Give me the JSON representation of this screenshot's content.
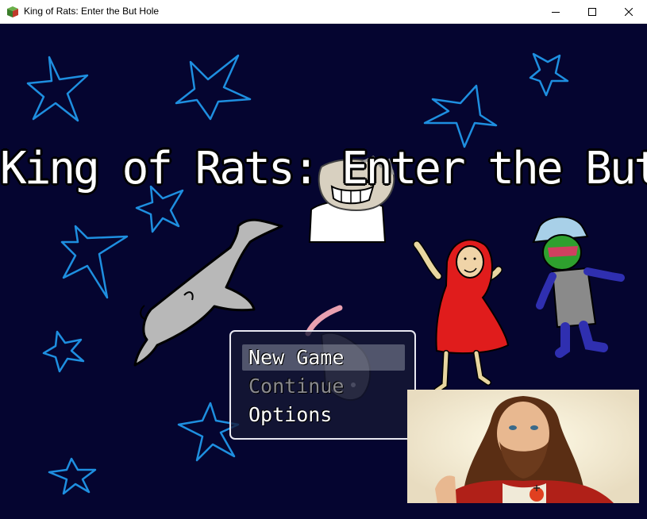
{
  "window": {
    "title": "King of Rats: Enter the But Hole",
    "controls": [
      "minimize-icon",
      "maximize-icon",
      "close-icon"
    ]
  },
  "game": {
    "title": "King of Rats: Enter the But Hole",
    "background_color": "#050530",
    "menu": {
      "items": [
        {
          "label": "New Game",
          "state": "selected"
        },
        {
          "label": "Continue",
          "state": "disabled"
        },
        {
          "label": "Options",
          "state": "enabled"
        }
      ]
    }
  }
}
